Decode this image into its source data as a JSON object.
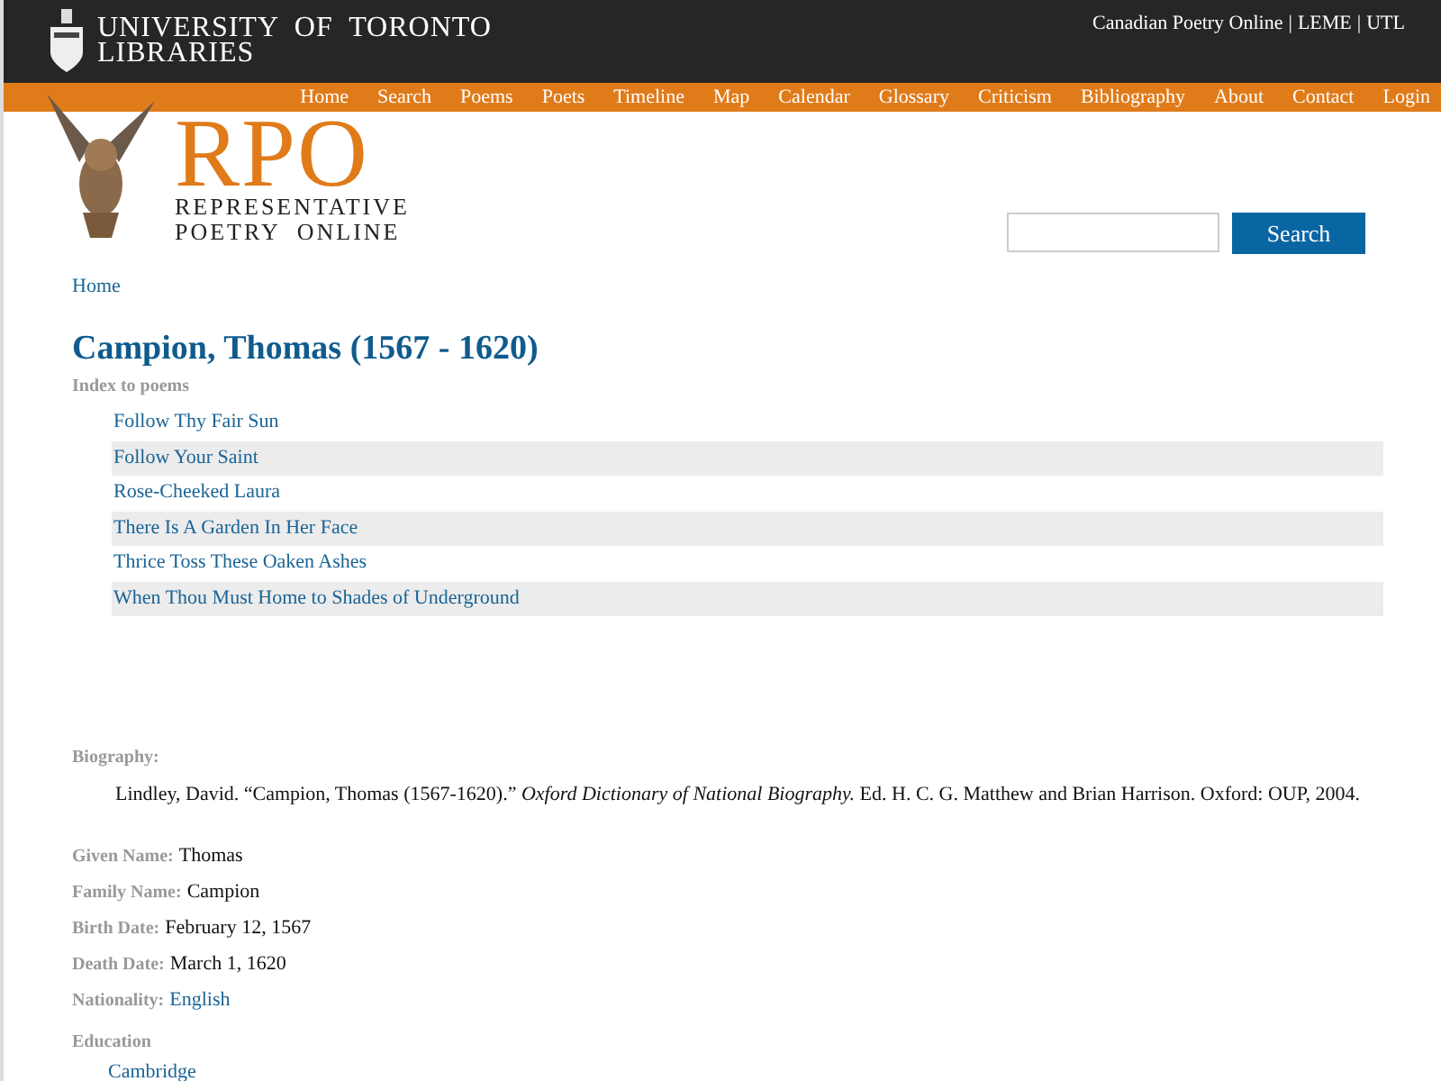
{
  "header": {
    "logo_line1": "UNIVERSITY  OF  TORONTO",
    "logo_line2": "LIBRARIES",
    "links": [
      "Canadian Poetry Online",
      "LEME",
      "UTL"
    ],
    "separator": "|"
  },
  "nav": [
    "Home",
    "Search",
    "Poems",
    "Poets",
    "Timeline",
    "Map",
    "Calendar",
    "Glossary",
    "Criticism",
    "Bibliography",
    "About",
    "Contact",
    "Login"
  ],
  "brand": {
    "title": "RPO",
    "line1": "REPRESENTATIVE",
    "line2": "POETRY  ONLINE"
  },
  "search": {
    "button": "Search"
  },
  "breadcrumb": "Home",
  "heading": "Campion, Thomas (1567 - 1620)",
  "index_label": "Index to poems",
  "poems": [
    "Follow Thy Fair Sun",
    "Follow Your Saint",
    "Rose-Cheeked Laura",
    "There Is A Garden In Her Face",
    "Thrice Toss These Oaken Ashes",
    "When Thou Must Home to Shades of Underground"
  ],
  "biography_label": "Biography:",
  "biography": "Lindley, David. “Campion, Thomas (1567-1620).” *Oxford Dictionary of National Biography.* Ed. H. C. G. Matthew and Brian Harrison. Oxford: OUP, 2004.",
  "facts": [
    {
      "label": "Given Name:",
      "value": "Thomas",
      "kind": "text"
    },
    {
      "label": "Family Name:",
      "value": "Campion",
      "kind": "text"
    },
    {
      "label": "Birth Date:",
      "value": "February 12, 1567",
      "kind": "text"
    },
    {
      "label": "Death Date:",
      "value": "March 1, 1620",
      "kind": "text"
    },
    {
      "label": "Nationality:",
      "value": "English",
      "kind": "link"
    }
  ],
  "education_label": "Education",
  "education": [
    "Cambridge"
  ]
}
